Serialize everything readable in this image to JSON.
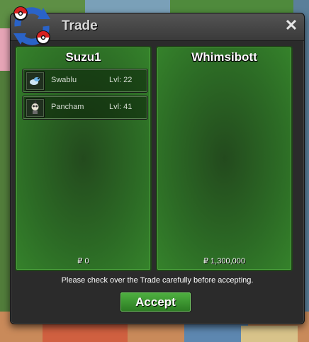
{
  "window": {
    "title": "Trade",
    "close_glyph": "✕"
  },
  "left_panel": {
    "name": "Suzu1",
    "money": "₽ 0",
    "items": [
      {
        "name": "Swablu",
        "level": "Lvl: 22",
        "icon": "swablu-icon"
      },
      {
        "name": "Pancham",
        "level": "Lvl: 41",
        "icon": "pancham-icon"
      }
    ]
  },
  "right_panel": {
    "name": "Whimsibott",
    "money": "₽ 1,300,000"
  },
  "notice": "Please check over the Trade carefully before accepting.",
  "accept_label": "Accept",
  "colors": {
    "panel_green": "#2c6b25",
    "accept_green": "#3d9632",
    "titlebar": "#454545"
  }
}
